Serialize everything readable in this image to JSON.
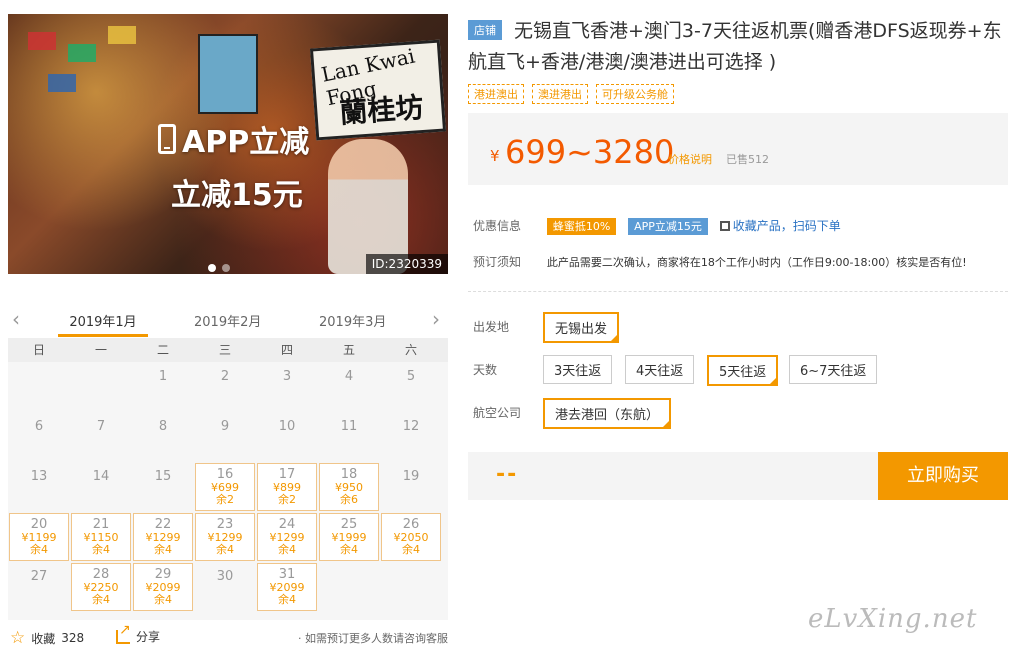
{
  "hero": {
    "app_line1": "APP立减",
    "app_line2": "立减15元",
    "sign_en": "Lan Kwai Fong",
    "sign_zh": "蘭桂坊",
    "id_tag": "ID:2320339"
  },
  "calendar": {
    "months": [
      "2019年1月",
      "2019年2月",
      "2019年3月"
    ],
    "active_month": "2019年1月",
    "weekdays": [
      "日",
      "一",
      "二",
      "三",
      "四",
      "五",
      "六"
    ],
    "days": [
      {
        "d": "",
        "p": "",
        "r": ""
      },
      {
        "d": "",
        "p": "",
        "r": ""
      },
      {
        "d": "1",
        "p": "",
        "r": ""
      },
      {
        "d": "2",
        "p": "",
        "r": ""
      },
      {
        "d": "3",
        "p": "",
        "r": ""
      },
      {
        "d": "4",
        "p": "",
        "r": ""
      },
      {
        "d": "5",
        "p": "",
        "r": ""
      },
      {
        "d": "6",
        "p": "",
        "r": ""
      },
      {
        "d": "7",
        "p": "",
        "r": ""
      },
      {
        "d": "8",
        "p": "",
        "r": ""
      },
      {
        "d": "9",
        "p": "",
        "r": ""
      },
      {
        "d": "10",
        "p": "",
        "r": ""
      },
      {
        "d": "11",
        "p": "",
        "r": ""
      },
      {
        "d": "12",
        "p": "",
        "r": ""
      },
      {
        "d": "13",
        "p": "",
        "r": ""
      },
      {
        "d": "14",
        "p": "",
        "r": ""
      },
      {
        "d": "15",
        "p": "",
        "r": ""
      },
      {
        "d": "16",
        "p": "¥699",
        "r": "余2"
      },
      {
        "d": "17",
        "p": "¥899",
        "r": "余2"
      },
      {
        "d": "18",
        "p": "¥950",
        "r": "余6"
      },
      {
        "d": "19",
        "p": "",
        "r": ""
      },
      {
        "d": "20",
        "p": "¥1199",
        "r": "余4"
      },
      {
        "d": "21",
        "p": "¥1150",
        "r": "余4"
      },
      {
        "d": "22",
        "p": "¥1299",
        "r": "余4"
      },
      {
        "d": "23",
        "p": "¥1299",
        "r": "余4"
      },
      {
        "d": "24",
        "p": "¥1299",
        "r": "余4"
      },
      {
        "d": "25",
        "p": "¥1999",
        "r": "余4"
      },
      {
        "d": "26",
        "p": "¥2050",
        "r": "余4"
      },
      {
        "d": "27",
        "p": "",
        "r": ""
      },
      {
        "d": "28",
        "p": "¥2250",
        "r": "余4"
      },
      {
        "d": "29",
        "p": "¥2099",
        "r": "余4"
      },
      {
        "d": "30",
        "p": "",
        "r": ""
      },
      {
        "d": "31",
        "p": "¥2099",
        "r": "余4"
      }
    ]
  },
  "footer": {
    "fav_label": "收藏",
    "fav_count": "328",
    "share_label": "分享",
    "consult": "· 如需预订更多人数请咨询客服"
  },
  "product": {
    "shop_tag": "店铺",
    "title": "无锡直飞香港+澳门3-7天往返机票(赠香港DFS返现券+东航直飞+香港/港澳/澳港进出可选择 )",
    "tags": [
      "港进澳出",
      "澳进港出",
      "可升级公务舱"
    ],
    "price_symbol": "¥",
    "price": "699~3280",
    "price_note": "价格说明",
    "sold": "已售512"
  },
  "promo": {
    "label": "优惠信息",
    "badge1": "蜂蜜抵10%",
    "badge2": "APP立减15元",
    "qr_text": "收藏产品，扫码下单"
  },
  "notice": {
    "label": "预订须知",
    "text": "此产品需要二次确认，商家将在18个工作小时内（工作日9:00-18:00）核实是否有位!"
  },
  "options": {
    "depart_label": "出发地",
    "depart_value": "无锡出发",
    "days_label": "天数",
    "days": [
      "3天往返",
      "4天往返",
      "5天往返",
      "6~7天往返"
    ],
    "days_selected": "5天往返",
    "airline_label": "航空公司",
    "airline_value": "港去港回（东航）"
  },
  "buy": {
    "placeholder": "--",
    "button": "立即购买"
  },
  "watermark": "eLvXing.net",
  "colors": {
    "accent": "#f39800",
    "price": "#f35a00",
    "blue": "#5b9bd5"
  }
}
